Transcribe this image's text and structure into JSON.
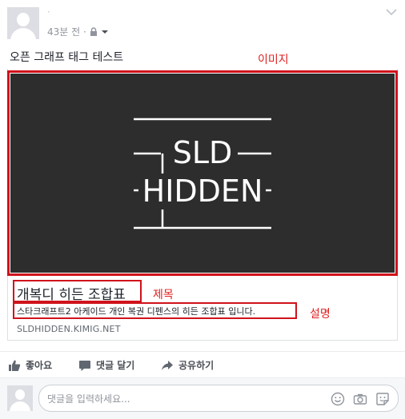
{
  "post": {
    "author_name": "·",
    "time": "43분 전 ·",
    "text": "오픈 그래프 태그 테스트"
  },
  "annotations": {
    "image": "이미지",
    "title": "제목",
    "description": "설명"
  },
  "link_preview": {
    "image_logo_line1": "SLD",
    "image_logo_line2": "HIDDEN",
    "title": "개복디 히든 조합표",
    "description": "스타크래프트2 아케이드 개인 복권 디펜스의 히든 조합표 입니다.",
    "domain": "SLDHIDDEN.KIMIG.NET"
  },
  "actions": {
    "like": "좋아요",
    "comment": "댓글 달기",
    "share": "공유하기"
  },
  "comment_box": {
    "placeholder": "댓글을 입력하세요..."
  },
  "colors": {
    "annotation_red": "#d0121b",
    "image_bg": "#2d2d2d",
    "icon_gray": "#606770"
  }
}
